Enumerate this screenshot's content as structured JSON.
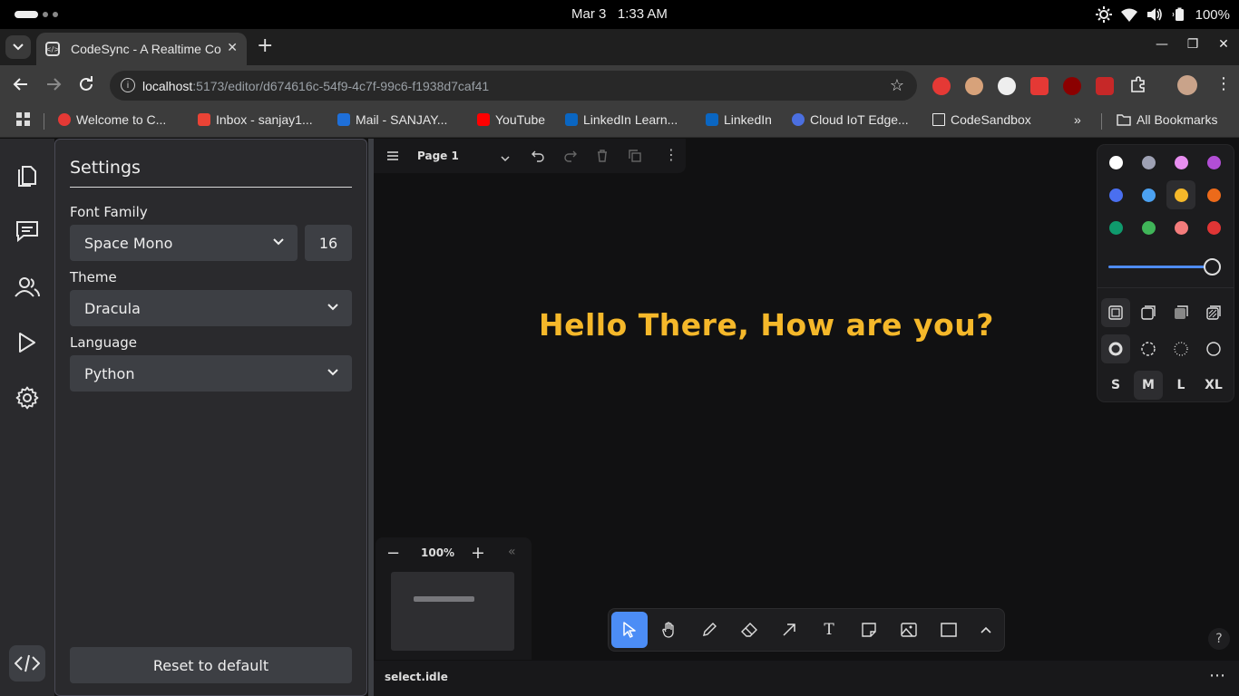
{
  "os": {
    "date": "Mar 3",
    "time": "1:33 AM",
    "battery": "100%"
  },
  "browser": {
    "tab_title": "CodeSync - A Realtime Co",
    "url_host": "localhost",
    "url_path": ":5173/editor/d674616c-54f9-4c7f-99c6-f1938d7caf41",
    "bookmarks": [
      {
        "label": "Welcome to C...",
        "color": "#e53935"
      },
      {
        "label": "Inbox - sanjay1...",
        "color": "#ea4335"
      },
      {
        "label": "Mail - SANJAY...",
        "color": "#1e6fd9"
      },
      {
        "label": "YouTube",
        "color": "#ff0000"
      },
      {
        "label": "LinkedIn Learn...",
        "color": "#0a66c2"
      },
      {
        "label": "LinkedIn",
        "color": "#0a66c2"
      },
      {
        "label": "Cloud IoT Edge...",
        "color": "#4b6fe0"
      },
      {
        "label": "CodeSandbox",
        "color": "#ffffff"
      }
    ],
    "more_bookmarks": "»",
    "all_bookmarks": "All Bookmarks"
  },
  "settings": {
    "title": "Settings",
    "font_family_label": "Font Family",
    "font_family_value": "Space Mono",
    "font_size_value": "16",
    "theme_label": "Theme",
    "theme_value": "Dracula",
    "language_label": "Language",
    "language_value": "Python",
    "reset_label": "Reset to default"
  },
  "canvas": {
    "page_name": "Page 1",
    "text": "Hello There, How are you?",
    "text_color": "#f5b82a",
    "zoom": "100%",
    "status": "select.idle",
    "help": "?"
  },
  "style_panel": {
    "colors": [
      "#ffffff",
      "#9ea1b4",
      "#e88ef0",
      "#b24ed6",
      "#4a6ff0",
      "#4ba1f1",
      "#f5b82a",
      "#ec6a1a",
      "#0f9a6d",
      "#40b559",
      "#f47c7c",
      "#e03535"
    ],
    "selected_color_index": 6,
    "opacity": 1.0,
    "sizes": [
      "S",
      "M",
      "L",
      "XL"
    ],
    "selected_size": "M"
  }
}
